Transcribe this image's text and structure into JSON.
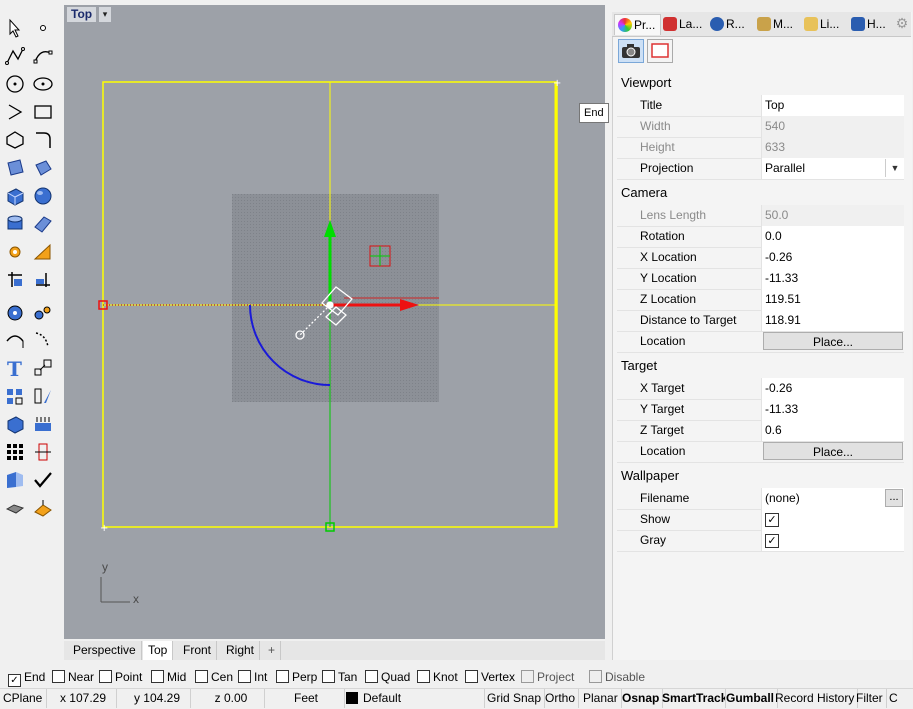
{
  "viewport": {
    "title": "Top",
    "menu_arrow": "▾",
    "axis_y": "y",
    "axis_x": "x",
    "tooltip": "End"
  },
  "view_tabs": [
    "Perspective",
    "Top",
    "Front",
    "Right",
    "+"
  ],
  "panel": {
    "tabs": [
      {
        "label": "Pr...",
        "icon": "properties-icon"
      },
      {
        "label": "La...",
        "icon": "layers-icon"
      },
      {
        "label": "R...",
        "icon": "render-icon"
      },
      {
        "label": "M...",
        "icon": "materials-icon"
      },
      {
        "label": "Li...",
        "icon": "libraries-icon"
      },
      {
        "label": "H...",
        "icon": "help-icon"
      }
    ],
    "sections": {
      "viewport": "Viewport",
      "camera": "Camera",
      "target": "Target",
      "wallpaper": "Wallpaper"
    },
    "viewport_rows": [
      {
        "label": "Title",
        "value": "Top"
      },
      {
        "label": "Width",
        "value": "540"
      },
      {
        "label": "Height",
        "value": "633"
      },
      {
        "label": "Projection",
        "value": "Parallel"
      }
    ],
    "camera_rows": [
      {
        "label": "Lens Length",
        "value": "50.0"
      },
      {
        "label": "Rotation",
        "value": "0.0"
      },
      {
        "label": "X Location",
        "value": "-0.26"
      },
      {
        "label": "Y Location",
        "value": "-11.33"
      },
      {
        "label": "Z Location",
        "value": "119.51"
      },
      {
        "label": "Distance to Target",
        "value": "118.91"
      },
      {
        "label": "Location",
        "value": "Place..."
      }
    ],
    "target_rows": [
      {
        "label": "X Target",
        "value": "-0.26"
      },
      {
        "label": "Y Target",
        "value": "-11.33"
      },
      {
        "label": "Z Target",
        "value": "0.6"
      },
      {
        "label": "Location",
        "value": "Place..."
      }
    ],
    "wallpaper_rows": [
      {
        "label": "Filename",
        "value": "(none)",
        "button": "..."
      },
      {
        "label": "Show",
        "checked": true
      },
      {
        "label": "Gray",
        "checked": true
      }
    ]
  },
  "osnap": [
    {
      "label": "End",
      "checked": true
    },
    {
      "label": "Near",
      "checked": false
    },
    {
      "label": "Point",
      "checked": false
    },
    {
      "label": "Mid",
      "checked": false
    },
    {
      "label": "Cen",
      "checked": false
    },
    {
      "label": "Int",
      "checked": false
    },
    {
      "label": "Perp",
      "checked": false
    },
    {
      "label": "Tan",
      "checked": false
    },
    {
      "label": "Quad",
      "checked": false
    },
    {
      "label": "Knot",
      "checked": false
    },
    {
      "label": "Vertex",
      "checked": false
    },
    {
      "label": "Project",
      "checked": false
    },
    {
      "label": "Disable",
      "checked": false
    }
  ],
  "status": {
    "cplane": "CPlane",
    "x": "x 107.29",
    "y": "y 104.29",
    "z": "z 0.00",
    "units": "Feet",
    "layer": "Default",
    "grid_snap": "Grid Snap",
    "ortho": "Ortho",
    "planar": "Planar",
    "osnap": "Osnap",
    "smarttrack": "SmartTrack",
    "gumball": "Gumball",
    "record_history": "Record History",
    "filter": "Filter",
    "more": "C"
  },
  "colors": {
    "viewport_bg": "#9da1a8",
    "selection_yellow": "#ffff00",
    "axis_green": "#00cc00",
    "axis_red": "#dd1111"
  }
}
